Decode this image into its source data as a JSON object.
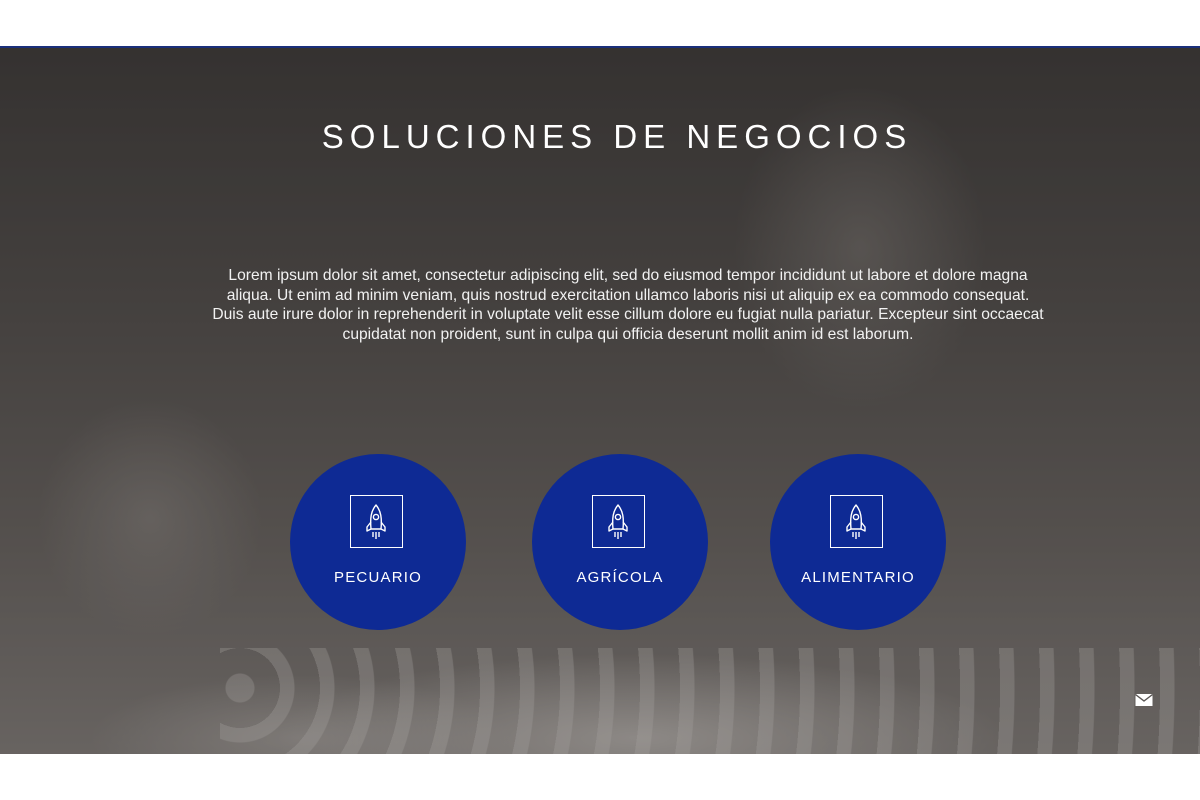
{
  "hero": {
    "title": "SOLUCIONES DE NEGOCIOS",
    "description": "Lorem ipsum dolor sit amet, consectetur adipiscing elit, sed do eiusmod tempor incididunt ut labore et dolore magna aliqua. Ut enim ad minim veniam, quis nostrud exercitation ullamco laboris nisi ut aliquip ex ea commodo consequat. Duis aute irure dolor in reprehenderit in voluptate velit esse cillum dolore eu fugiat nulla pariatur. Excepteur sint occaecat cupidatat non proident, sunt in culpa qui officia deserunt mollit anim id est laborum."
  },
  "solutions": [
    {
      "label": "PECUARIO",
      "icon": "rocket-icon"
    },
    {
      "label": "AGRÍCOLA",
      "icon": "rocket-icon"
    },
    {
      "label": "ALIMENTARIO",
      "icon": "rocket-icon"
    }
  ],
  "contact": {
    "icon": "mail-icon"
  },
  "colors": {
    "accent": "#0e2a94",
    "rule": "#1a2f7a",
    "text": "#ffffff"
  }
}
